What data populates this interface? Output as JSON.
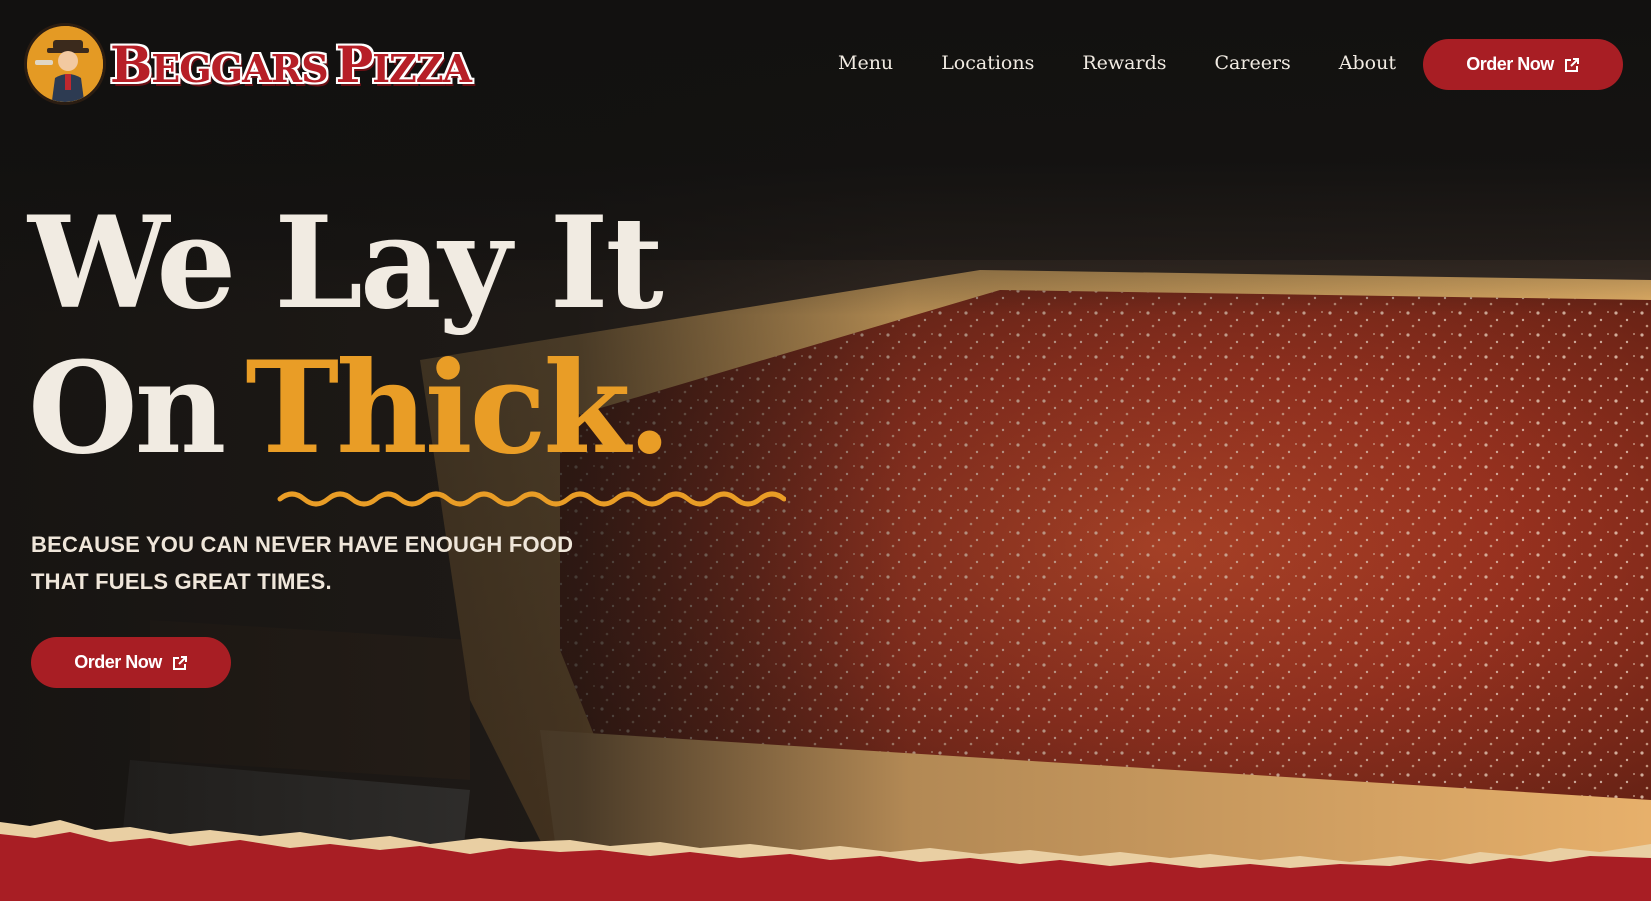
{
  "brand": {
    "name": "Beggars Pizza",
    "logo_icon": "beggar-mascot-icon",
    "colors": {
      "red": "#a81e24",
      "gold": "#e99d26",
      "cream": "#f1ebe2",
      "dark": "#131211"
    }
  },
  "nav": {
    "items": [
      {
        "label": "Menu"
      },
      {
        "label": "Locations"
      },
      {
        "label": "Rewards"
      },
      {
        "label": "Careers"
      },
      {
        "label": "About"
      }
    ],
    "order_label": "Order Now",
    "order_icon": "external-link-icon"
  },
  "hero": {
    "line1": "We Lay It",
    "line2_prefix": "On",
    "line2_accent": "Thick.",
    "tagline": "BECAUSE YOU CAN NEVER HAVE ENOUGH FOOD THAT FUELS GREAT TIMES.",
    "order_label": "Order Now",
    "order_icon": "external-link-icon",
    "background": "deep-dish-pizza-photo"
  }
}
